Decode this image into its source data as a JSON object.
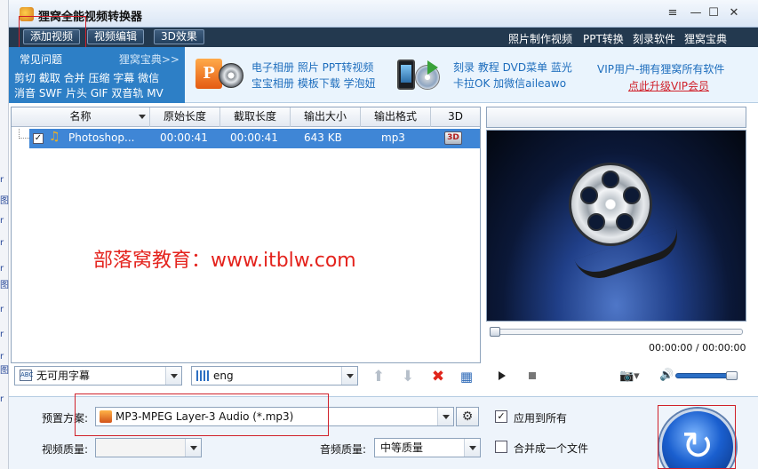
{
  "window": {
    "title": "狸窝全能视频转换器",
    "controls": [
      "≡",
      "—",
      "☐",
      "✕"
    ]
  },
  "toolbar": {
    "buttons": [
      "添加视频",
      "视频编辑",
      "3D效果"
    ],
    "links": [
      "照片制作视频",
      "PPT转换",
      "刻录软件",
      "狸窝宝典"
    ]
  },
  "left_strip": [
    "r",
    "r",
    "图",
    "r",
    "r",
    "r",
    "图",
    "r",
    "r",
    "图",
    "r"
  ],
  "ad": {
    "faq": "常见问题",
    "guide": "狸窝宝典>>",
    "tools_line1": "剪切 截取 合并 压缩 字幕 微信",
    "tools_line2": "消音 SWF 片头 GIF 双音轨 MV",
    "middle_line1": "电子相册 照片 PPT转视频",
    "middle_line2": "宝宝相册 模板下载 学泡妞",
    "right_line1": "刻录 教程 DVD菜单 蓝光",
    "right_line2": "卡拉OK 加微信aileawo",
    "vip_line1": "VIP用户-拥有狸窝所有软件",
    "vip_line2": "点此升级VIP会员",
    "icons": [
      "powerpoint-icon",
      "film-reel-icon",
      "phone-icon",
      "dvd-icon"
    ]
  },
  "file_list": {
    "headers": [
      "名称",
      "原始长度",
      "截取长度",
      "输出大小",
      "输出格式",
      "3D"
    ],
    "rows": [
      {
        "name": "Photoshop...",
        "original": "00:00:41",
        "clip": "00:00:41",
        "size": "643 KB",
        "format": "mp3",
        "checked": true
      }
    ],
    "watermark": "部落窝教育：www.itblw.com"
  },
  "subtitle_select": {
    "value": "无可用字幕",
    "icon": "ABC"
  },
  "audio_select": {
    "value": "eng"
  },
  "list_actions": [
    "up-arrow-icon",
    "down-arrow-icon",
    "delete-icon",
    "clear-list-icon"
  ],
  "player": {
    "time": "00:00:00 / 00:00:00",
    "volume": 1.0,
    "progress": 0.0
  },
  "bottom": {
    "preset_label": "预置方案:",
    "preset_value": "MP3-MPEG Layer-3 Audio (*.mp3)",
    "apply_all": "应用到所有",
    "apply_all_checked": true,
    "video_quality_label": "视频质量:",
    "video_quality_value": "",
    "audio_quality_label": "音频质量:",
    "audio_quality_value": "中等质量",
    "merge_label": "合并成一个文件",
    "merge_checked": false
  },
  "colors": {
    "toolbar": "#23394f",
    "accent": "#2d7fc6",
    "selected_row": "#3f86d6",
    "highlight_box": "#d0202a",
    "watermark": "#e4231d"
  }
}
